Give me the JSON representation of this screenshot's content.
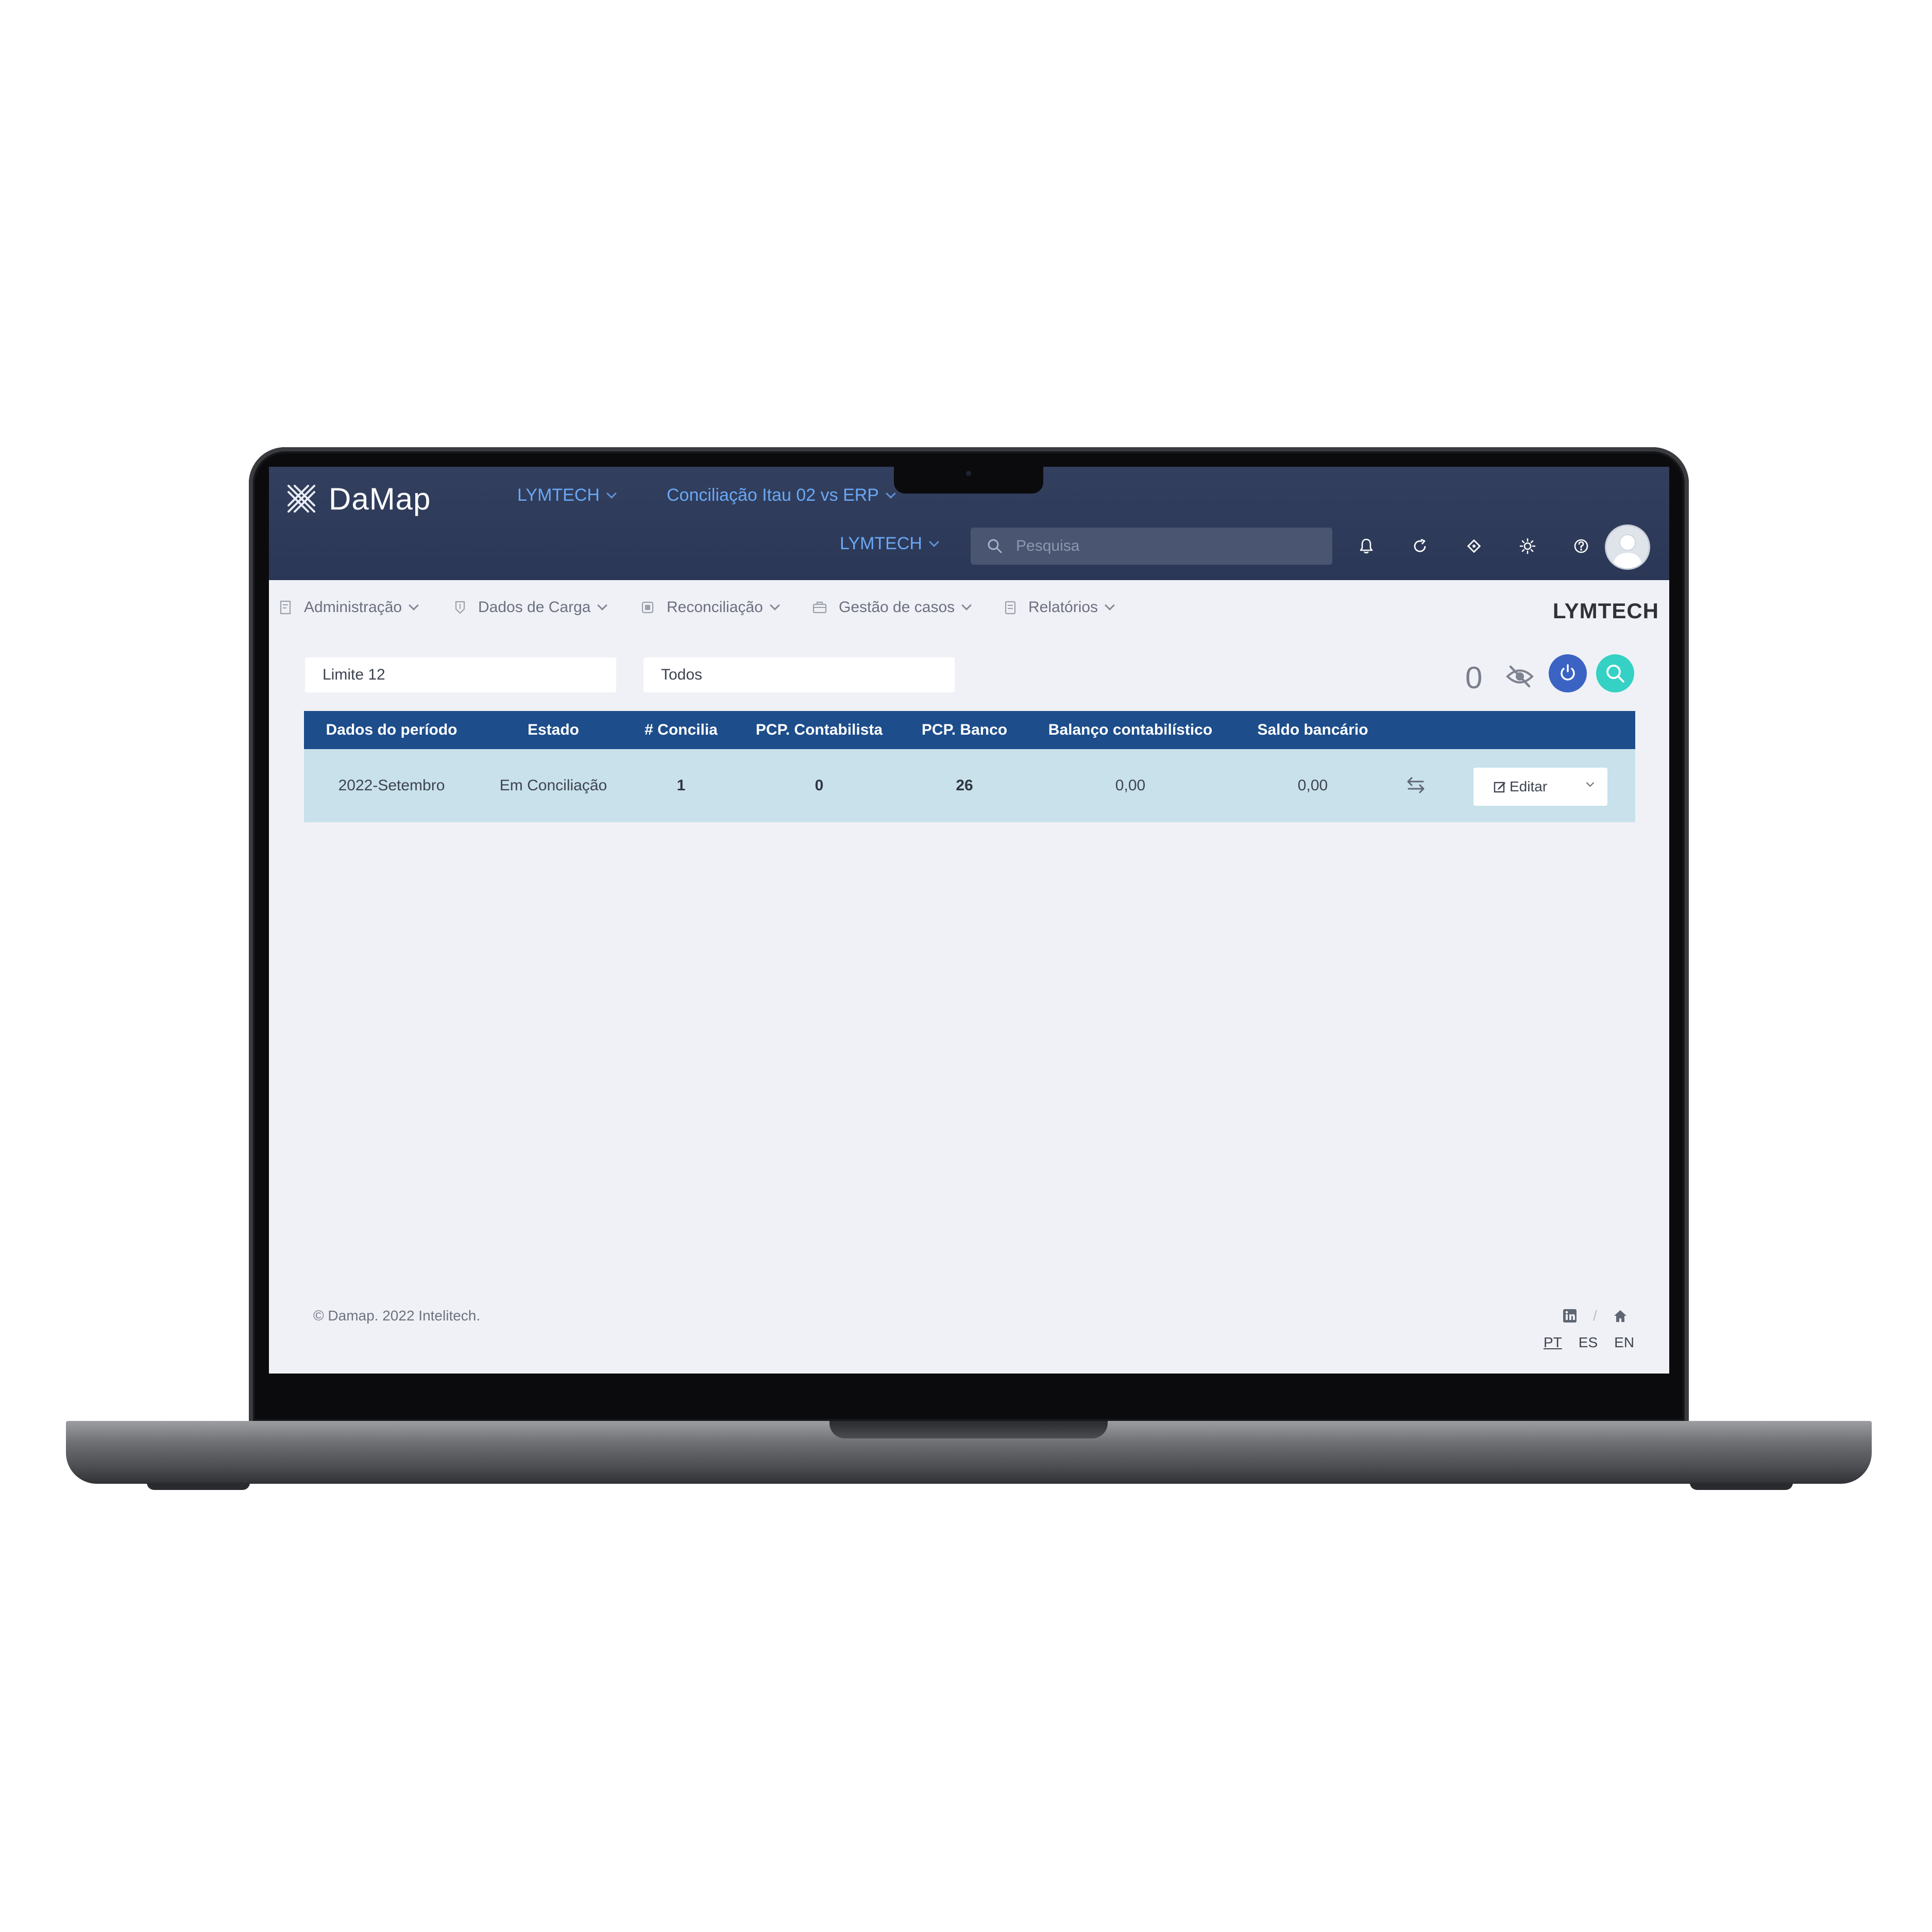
{
  "app": {
    "name": "DaMap"
  },
  "topbar": {
    "company_dropdown": "LYMTECH",
    "reconciliation_dropdown": "Conciliação Itau 02 vs ERP",
    "entity_dropdown": "LYMTECH",
    "search": {
      "placeholder": "Pesquisa",
      "value": ""
    },
    "icons": [
      "bell-icon",
      "refresh-icon",
      "diamond-icon",
      "sun-icon",
      "help-icon",
      "avatar"
    ]
  },
  "menu": {
    "items": [
      {
        "label": "Administração",
        "icon": "admin-icon"
      },
      {
        "label": "Dados de Carga",
        "icon": "load-data-icon"
      },
      {
        "label": "Reconciliação",
        "icon": "reconciliation-icon"
      },
      {
        "label": "Gestão de casos",
        "icon": "briefcase-icon"
      },
      {
        "label": "Relatórios",
        "icon": "reports-icon"
      }
    ],
    "company_title": "LYMTECH"
  },
  "filters": {
    "limit": "Limite 12",
    "status": "Todos"
  },
  "toolbar": {
    "hidden_count": "0"
  },
  "table": {
    "headers": [
      "Dados do período",
      "Estado",
      "# Concilia",
      "PCP. Contabilista",
      "PCP. Banco",
      "Balanço contabilístico",
      "Saldo bancário"
    ],
    "rows": [
      {
        "period": "2022-Setembro",
        "status": "Em Conciliação",
        "concilia": "1",
        "pcp_contabilista": "0",
        "pcp_banco": "26",
        "balanco": "0,00",
        "saldo": "0,00",
        "action_label": "Editar"
      }
    ]
  },
  "footer": {
    "copyright": "© Damap. 2022 Intelitech.",
    "separator": "/",
    "languages": [
      "PT",
      "ES",
      "EN"
    ],
    "active_language": "PT"
  },
  "colors": {
    "topbar": "#2e3a58",
    "accent_link": "#69a8f5",
    "table_header": "#1d4d8b",
    "row_bg": "#c8e1eb",
    "refresh_button": "#3b63c4",
    "search_button": "#35d1c5"
  }
}
